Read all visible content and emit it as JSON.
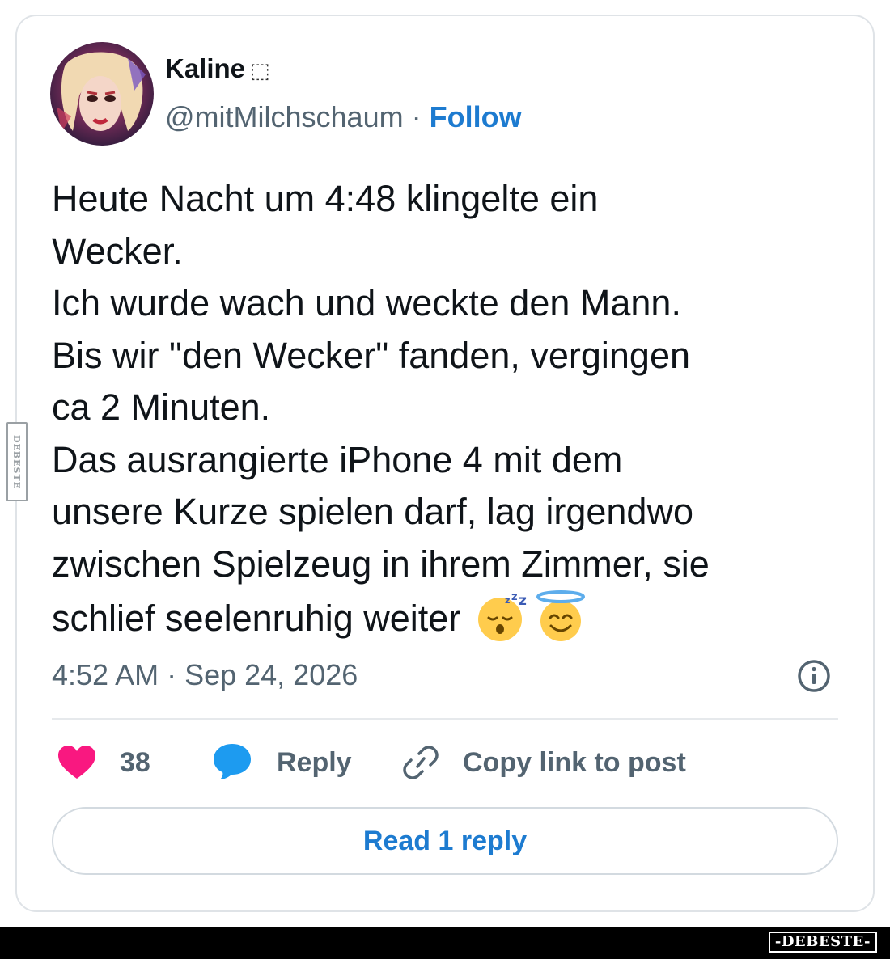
{
  "post": {
    "author": {
      "display_name": "Kaline",
      "name_emoji": "⬚",
      "handle": "@mitMilchschaum",
      "separator": "·",
      "follow_label": "Follow",
      "avatar_icon": "profile-photo"
    },
    "text_lines": [
      "Heute Nacht um 4:48 klingelte ein",
      "Wecker.",
      "Ich wurde wach und weckte den Mann.",
      "Bis wir \"den Wecker\" fanden, vergingen",
      "ca 2 Minuten.",
      "Das ausrangierte iPhone 4 mit dem",
      "unsere Kurze spielen darf, lag irgendwo",
      "zwischen Spielzeug in ihrem Zimmer, sie",
      "schlief seelenruhig weiter"
    ],
    "text_emojis": [
      "sleeping-face-emoji",
      "smiling-face-with-halo-emoji"
    ],
    "timestamp": "4:52 AM · Sep 24, 2026"
  },
  "actions": {
    "like_count": "38",
    "reply_label": "Reply",
    "copy_link_label": "Copy link to post",
    "read_replies_label": "Read 1 reply"
  },
  "watermark": {
    "side_text": "DEBESTE",
    "footer_logo": "-DEBESTE-"
  },
  "colors": {
    "link_blue": "#1d7bd0",
    "reply_icon_blue": "#1d9bf0",
    "like_pink": "#f91880",
    "secondary_text": "#536471",
    "primary_text": "#0f1419",
    "card_border": "#dfe3e7"
  }
}
